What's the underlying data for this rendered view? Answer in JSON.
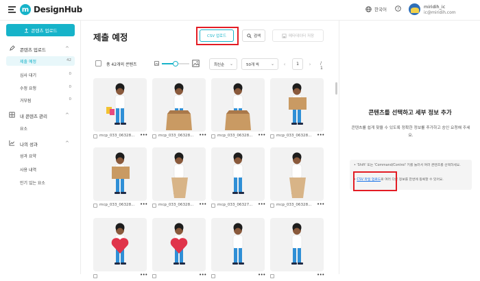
{
  "app": {
    "brand": "DesignHub",
    "brand_initial": "m",
    "accent": "#16b3c9"
  },
  "header": {
    "language": "한국어",
    "user_name": "miridih_ic",
    "user_email": "ic@miridih.com"
  },
  "sidebar": {
    "upload_button": "콘텐츠 업로드",
    "groups": [
      {
        "label": "콘텐츠 업로드",
        "icon": "pencil-icon",
        "items": [
          {
            "label": "제출 예정",
            "count": "42",
            "active": true
          },
          {
            "label": "심사 대기",
            "count": "0"
          },
          {
            "label": "수정 요청",
            "count": "0"
          },
          {
            "label": "거부됨",
            "count": "0"
          }
        ]
      },
      {
        "label": "내 콘텐츠 관리",
        "icon": "grid-icon",
        "items": [
          {
            "label": "요소"
          }
        ]
      },
      {
        "label": "나의 성과",
        "icon": "chart-icon",
        "items": [
          {
            "label": "성과 요약"
          },
          {
            "label": "사용 내역"
          },
          {
            "label": "인기 있는 요소"
          }
        ]
      }
    ]
  },
  "main": {
    "title": "제출 예정",
    "csv_button": "CSV 업로드",
    "search_button": "검색",
    "meta_button": "메타데이터 저장",
    "total_count": "총 42개의 콘텐츠",
    "thumb_size_level": 0.5,
    "sort": "최신순",
    "per_page": "50개 씩",
    "page": "1",
    "page_total": "/ 1",
    "cards": [
      {
        "name": "mcp_033_06328..."
      },
      {
        "name": "mcp_033_06328..."
      },
      {
        "name": "mcp_033_06328..."
      },
      {
        "name": "mcp_033_06328..."
      },
      {
        "name": "mcp_033_06328..."
      },
      {
        "name": "mcp_033_06328..."
      },
      {
        "name": "mcp_033_06327..."
      },
      {
        "name": "mcp_033_06328..."
      },
      {
        "name": ""
      },
      {
        "name": ""
      },
      {
        "name": ""
      },
      {
        "name": ""
      }
    ]
  },
  "right_panel": {
    "title": "콘텐츠를 선택하고 세부 정보 추가",
    "description": "콘텐츠를 쉽게 찾을 수 있도록 정확한 정보를 추가하고 승인 요청해 주세요.",
    "tip1": "• 'Shift' 또는 'Command/Control' 키를 눌러서 여러 콘텐츠를 선택하세요.",
    "tip2_link": "CSV 파일 업로드",
    "tip2_rest": "로 여러 다른 정보를 한번에 등록할 수 있어요."
  }
}
